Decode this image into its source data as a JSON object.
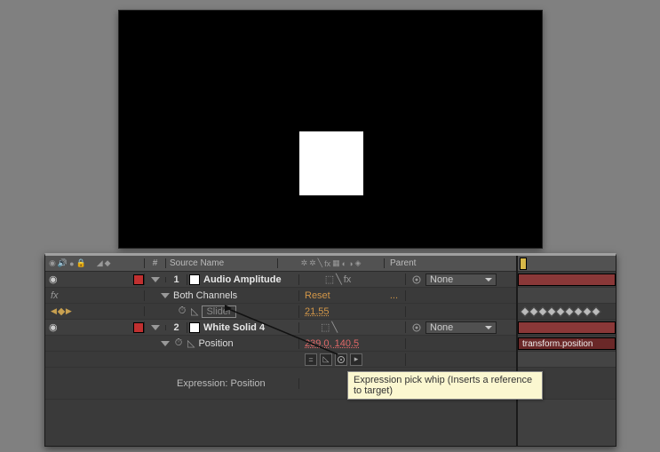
{
  "headers": {
    "source_name": "Source Name",
    "parent": "Parent",
    "num_symbol": "#"
  },
  "layers": [
    {
      "index": "1",
      "name": "Audio Amplitude",
      "parent": "None",
      "effect": {
        "name": "Both Channels",
        "reset": "Reset",
        "slider_label": "Slider",
        "slider_value": "21.55"
      }
    },
    {
      "index": "2",
      "name": "White Solid 4",
      "parent": "None",
      "transform": {
        "name": "Position",
        "value": "239.0, 140.5",
        "expression_label": "Expression: Position",
        "expression_text": "transform.position"
      }
    }
  ],
  "tooltip": "Expression pick whip (Inserts a reference to target)",
  "fx_label": "fx",
  "dots": "..."
}
